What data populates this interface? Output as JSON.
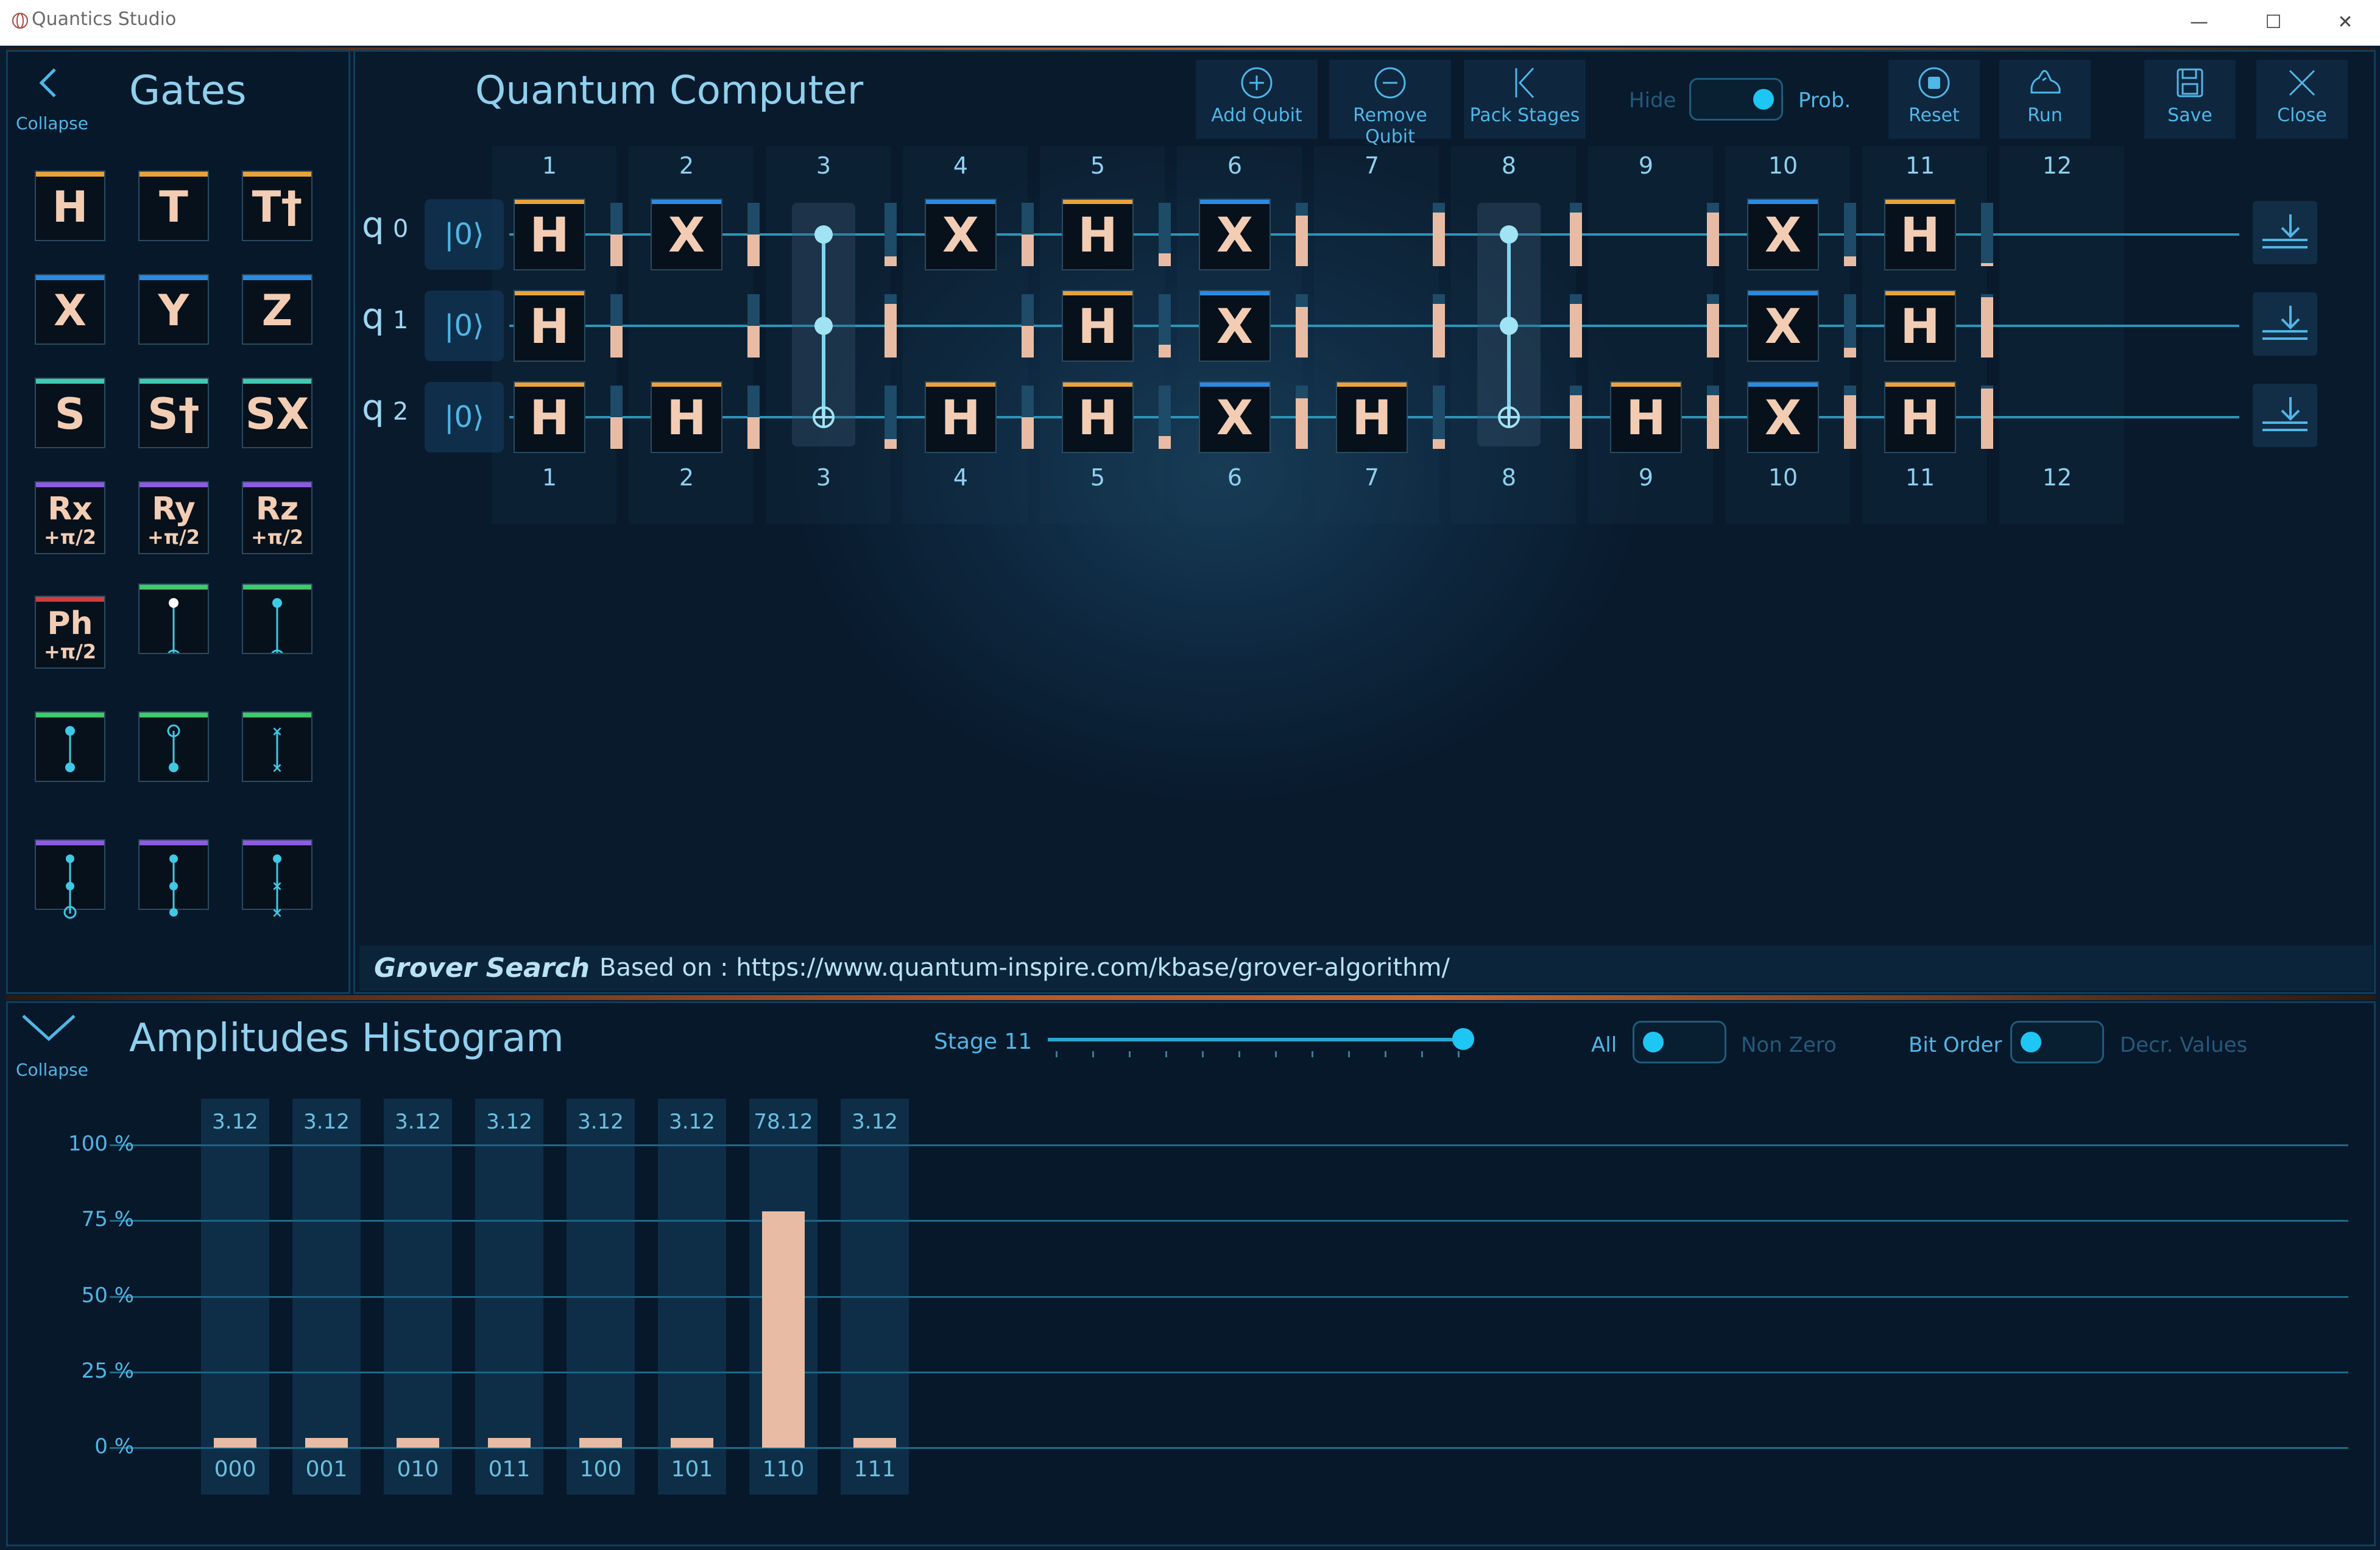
{
  "window": {
    "title": "Quantics Studio",
    "minimize": "—",
    "maximize": "☐",
    "close": "✕"
  },
  "gates_panel": {
    "collapse_label": "Collapse",
    "title": "Gates",
    "tiles": [
      {
        "label": "H",
        "color": "#e9a23b"
      },
      {
        "label": "T",
        "color": "#e9a23b"
      },
      {
        "label": "T†",
        "color": "#e9a23b"
      },
      {
        "label": "X",
        "color": "#2b8be0"
      },
      {
        "label": "Y",
        "color": "#2b8be0"
      },
      {
        "label": "Z",
        "color": "#2b8be0"
      },
      {
        "label": "S",
        "color": "#3ec9b0"
      },
      {
        "label": "S†",
        "color": "#3ec9b0"
      },
      {
        "label": "SX",
        "color": "#3ec9b0"
      },
      {
        "label": "Rx",
        "sub": "+π/2",
        "color": "#8e5ae0"
      },
      {
        "label": "Ry",
        "sub": "+π/2",
        "color": "#8e5ae0"
      },
      {
        "label": "Rz",
        "sub": "+π/2",
        "color": "#8e5ae0"
      },
      {
        "label": "Ph",
        "sub": "+π/2",
        "color": "#d43b3b"
      }
    ]
  },
  "circuit": {
    "title": "Quantum Computer",
    "toolbar": {
      "add_qubit": "Add Qubit",
      "remove_qubit": "Remove Qubit",
      "pack_stages": "Pack Stages",
      "hide": "Hide",
      "prob": "Prob.",
      "reset": "Reset",
      "run": "Run",
      "save": "Save",
      "close": "Close"
    },
    "stages": [
      "1",
      "2",
      "3",
      "4",
      "5",
      "6",
      "7",
      "8",
      "9",
      "10",
      "11",
      "12"
    ],
    "qubits": [
      {
        "label": "q",
        "index": "0",
        "ket": "|0⟩"
      },
      {
        "label": "q",
        "index": "1",
        "ket": "|0⟩"
      },
      {
        "label": "q",
        "index": "2",
        "ket": "|0⟩"
      }
    ],
    "gates": [
      {
        "q": 0,
        "s": 1,
        "g": "H",
        "c": "#e9a23b"
      },
      {
        "q": 1,
        "s": 1,
        "g": "H",
        "c": "#e9a23b"
      },
      {
        "q": 2,
        "s": 1,
        "g": "H",
        "c": "#e9a23b"
      },
      {
        "q": 0,
        "s": 2,
        "g": "X",
        "c": "#2b8be0"
      },
      {
        "q": 2,
        "s": 2,
        "g": "H",
        "c": "#e9a23b"
      },
      {
        "q": 0,
        "s": 4,
        "g": "X",
        "c": "#2b8be0"
      },
      {
        "q": 2,
        "s": 4,
        "g": "H",
        "c": "#e9a23b"
      },
      {
        "q": 0,
        "s": 5,
        "g": "H",
        "c": "#e9a23b"
      },
      {
        "q": 1,
        "s": 5,
        "g": "H",
        "c": "#e9a23b"
      },
      {
        "q": 2,
        "s": 5,
        "g": "H",
        "c": "#e9a23b"
      },
      {
        "q": 0,
        "s": 6,
        "g": "X",
        "c": "#2b8be0"
      },
      {
        "q": 1,
        "s": 6,
        "g": "X",
        "c": "#2b8be0"
      },
      {
        "q": 2,
        "s": 6,
        "g": "X",
        "c": "#2b8be0"
      },
      {
        "q": 2,
        "s": 7,
        "g": "H",
        "c": "#e9a23b"
      },
      {
        "q": 2,
        "s": 9,
        "g": "H",
        "c": "#e9a23b"
      },
      {
        "q": 0,
        "s": 10,
        "g": "X",
        "c": "#2b8be0"
      },
      {
        "q": 1,
        "s": 10,
        "g": "X",
        "c": "#2b8be0"
      },
      {
        "q": 2,
        "s": 10,
        "g": "X",
        "c": "#2b8be0"
      },
      {
        "q": 0,
        "s": 11,
        "g": "H",
        "c": "#e9a23b"
      },
      {
        "q": 1,
        "s": 11,
        "g": "H",
        "c": "#e9a23b"
      },
      {
        "q": 2,
        "s": 11,
        "g": "H",
        "c": "#e9a23b"
      }
    ],
    "controlled": [
      {
        "s": 3
      },
      {
        "s": 8
      }
    ],
    "probabilities": [
      [
        0.5,
        0.5,
        0.5
      ],
      [
        0.5,
        0.5,
        0.5
      ],
      [
        0.15,
        0.85,
        0.15
      ],
      [
        0.5,
        0.5,
        0.5
      ],
      [
        0.2,
        0.2,
        0.2
      ],
      [
        0.8,
        0.8,
        0.8
      ],
      [
        0.85,
        0.85,
        0.15
      ],
      [
        0.85,
        0.85,
        0.85
      ],
      [
        0.85,
        0.85,
        0.85
      ],
      [
        0.15,
        0.15,
        0.85
      ],
      [
        0.05,
        0.95,
        0.95
      ]
    ],
    "sample_name": "Grover Search",
    "sample_source": "Based on : https://www.quantum-inspire.com/kbase/grover-algorithm/"
  },
  "histogram": {
    "collapse_label": "Collapse",
    "title": "Amplitudes Histogram",
    "stage_label": "Stage 11",
    "slider_value": 11,
    "slider_max": 11,
    "filter_all": "All",
    "filter_nonzero": "Non Zero",
    "bit_order": "Bit Order",
    "decr_values": "Decr. Values",
    "y_ticks": [
      "100 %",
      "75 %",
      "50 %",
      "25 %",
      "0 %"
    ]
  },
  "chart_data": {
    "type": "bar",
    "categories": [
      "000",
      "001",
      "010",
      "011",
      "100",
      "101",
      "110",
      "111"
    ],
    "values": [
      3.12,
      3.12,
      3.12,
      3.12,
      3.12,
      3.12,
      78.12,
      3.12
    ],
    "value_labels": [
      "3.12",
      "3.12",
      "3.12",
      "3.12",
      "3.12",
      "3.12",
      "78.12",
      "3.12"
    ],
    "ylim": [
      0,
      100
    ],
    "yticks": [
      "100 %",
      "75 %",
      "50 %",
      "25 %",
      "0 %"
    ],
    "bar_color": "#e8bca4",
    "grid": true
  }
}
